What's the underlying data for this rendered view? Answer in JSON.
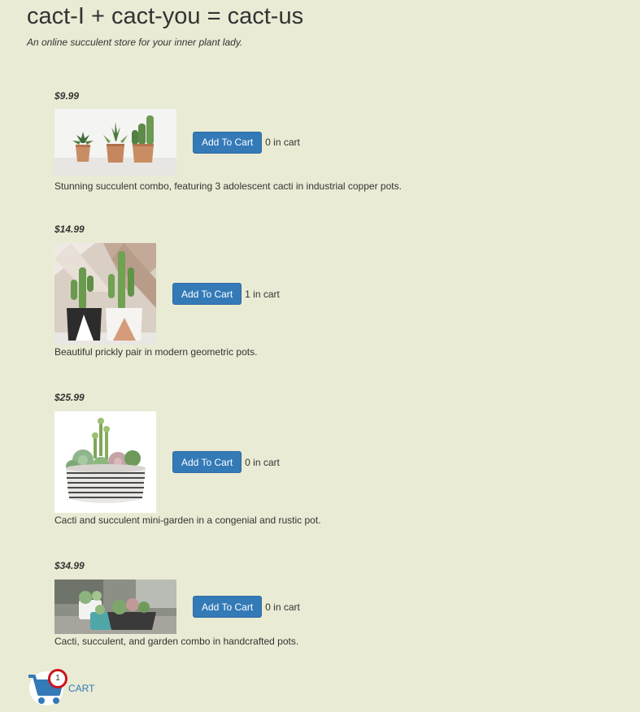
{
  "header": {
    "title": "cact-I + cact-you = cact-us",
    "tagline": "An online succulent store for your inner plant lady."
  },
  "products": [
    {
      "price": "$9.99",
      "button_label": "Add To Cart",
      "in_cart": "0 in cart",
      "description": "Stunning succulent combo, featuring 3 adolescent cacti in industrial copper pots."
    },
    {
      "price": "$14.99",
      "button_label": "Add To Cart",
      "in_cart": "1 in cart",
      "description": "Beautiful prickly pair in modern geometric pots."
    },
    {
      "price": "$25.99",
      "button_label": "Add To Cart",
      "in_cart": "0 in cart",
      "description": "Cacti and succulent mini-garden in a congenial and rustic pot."
    },
    {
      "price": "$34.99",
      "button_label": "Add To Cart",
      "in_cart": "0 in cart",
      "description": "Cacti, succulent, and garden combo in handcrafted pots."
    }
  ],
  "cart": {
    "count": "1",
    "label": "CART"
  },
  "colors": {
    "background": "#eaebd4",
    "button": "#337ab7",
    "badge_ring": "#c9151e",
    "link": "#337ab7"
  }
}
